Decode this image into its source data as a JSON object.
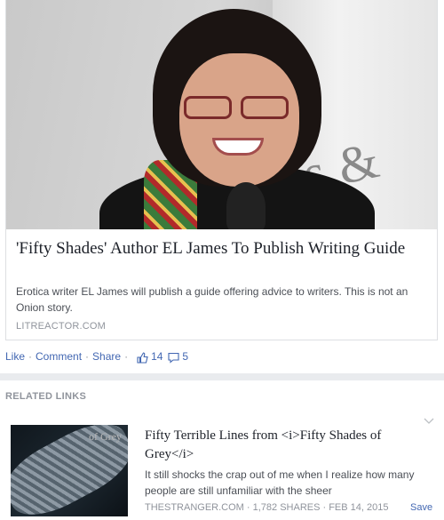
{
  "post": {
    "title": "'Fifty Shades' Author EL James To Publish Writing Guide",
    "description": "Erotica writer EL James will publish a guide offering advice to writers. This is not an Onion story.",
    "source": "LITREACTOR.COM",
    "image_bg_text": "es & No"
  },
  "actions": {
    "like": "Like",
    "comment": "Comment",
    "share": "Share",
    "separator": "·",
    "like_count": "14",
    "comment_count": "5",
    "accent": "#4267b2"
  },
  "related": {
    "heading": "RELATED LINKS",
    "items": [
      {
        "thumb_text": "of Grey",
        "title": "Fifty Terrible Lines from <i>Fifty Shades of Grey</i>",
        "description": "It still shocks the crap out of me when I realize how many people are still unfamiliar with the sheer",
        "meta": "THESTRANGER.COM · 1,782 SHARES · FEB 14, 2015",
        "save": "Save"
      }
    ]
  },
  "icons": {
    "like": "thumbs-up-icon",
    "comment": "comment-icon",
    "chevron": "chevron-down-icon"
  }
}
